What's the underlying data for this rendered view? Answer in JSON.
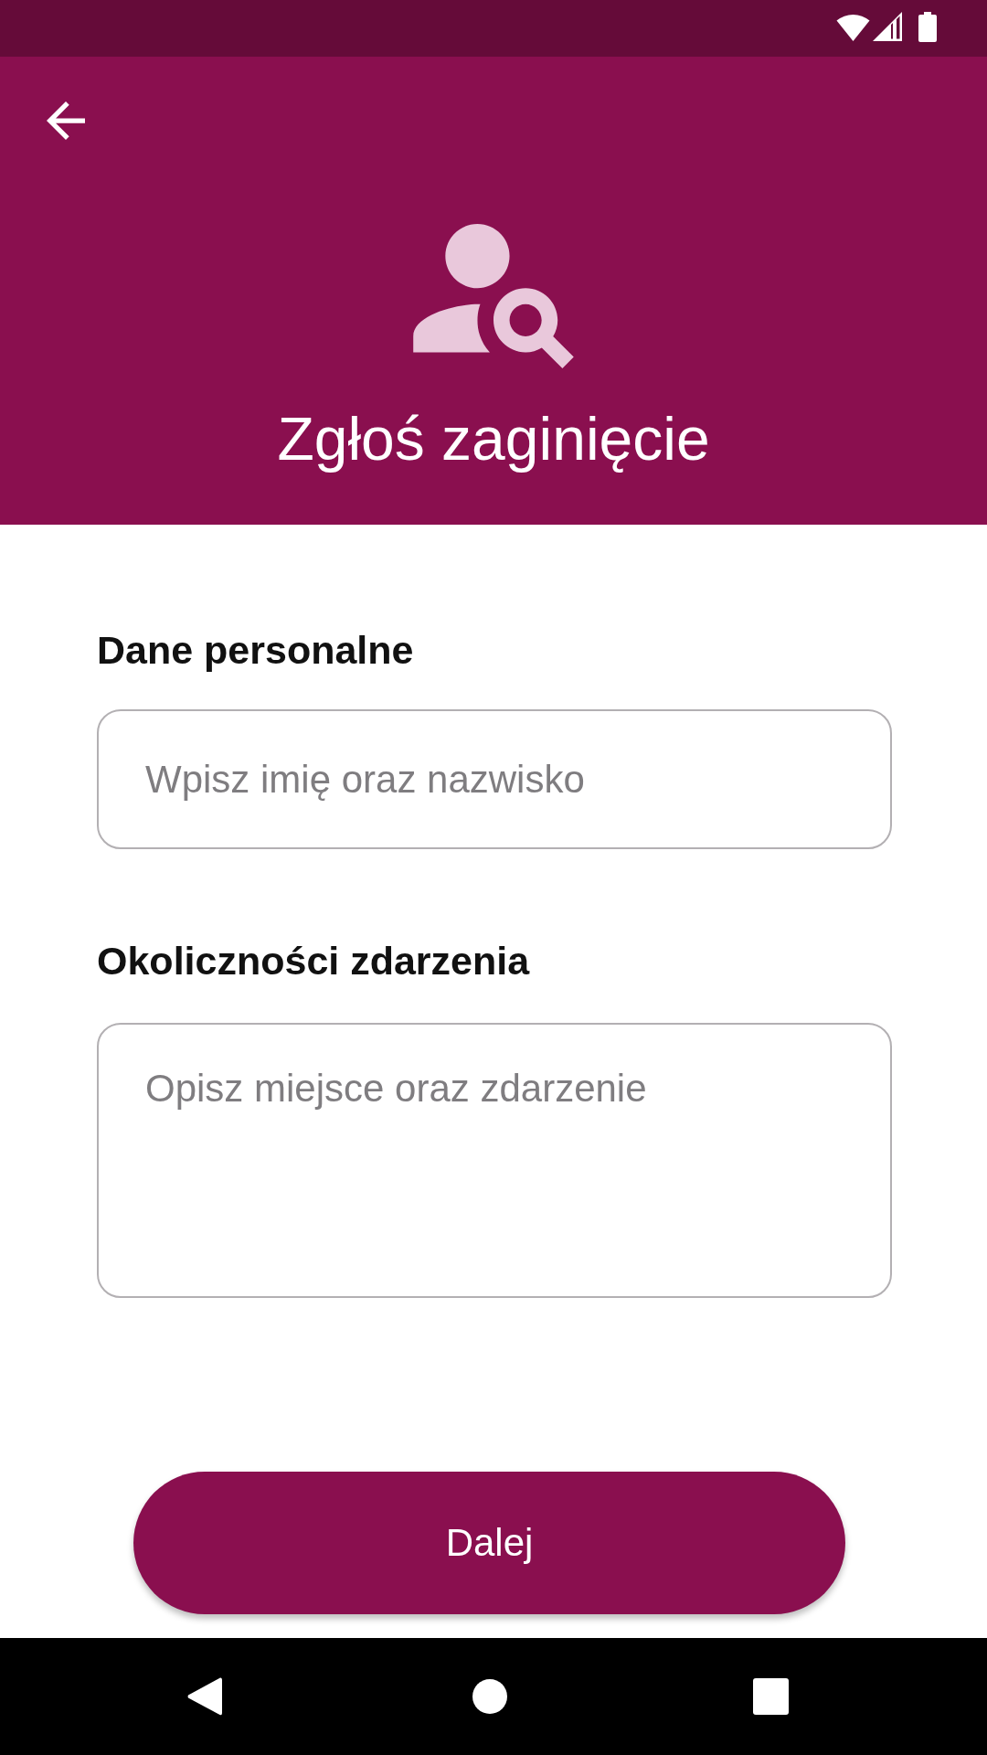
{
  "header": {
    "title": "Zgłoś zaginięcie"
  },
  "form": {
    "fields": [
      {
        "label": "Dane personalne",
        "placeholder": "Wpisz imię oraz nazwisko",
        "kind": "text"
      },
      {
        "label": "Okoliczności zdarzenia",
        "placeholder": "Opisz miejsce oraz zdarzenie",
        "kind": "textarea"
      }
    ]
  },
  "buttons": [
    {
      "label": "Dalej"
    }
  ]
}
